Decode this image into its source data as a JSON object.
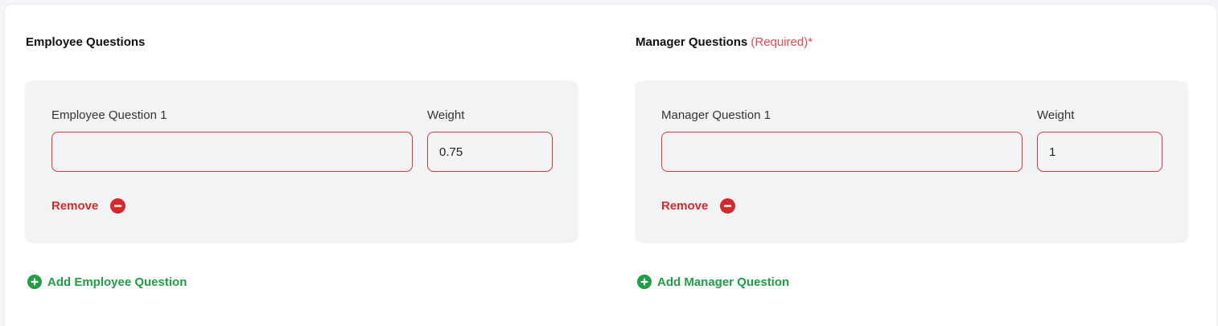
{
  "employee": {
    "title": "Employee Questions",
    "questions": [
      {
        "label": "Employee Question 1",
        "value": "",
        "weight_label": "Weight",
        "weight_value": "0.75",
        "remove_label": "Remove"
      }
    ],
    "add_label": "Add Employee Question"
  },
  "manager": {
    "title": "Manager Questions",
    "required_label": "(Required)*",
    "questions": [
      {
        "label": "Manager Question 1",
        "value": "",
        "weight_label": "Weight",
        "weight_value": "1",
        "remove_label": "Remove"
      }
    ],
    "add_label": "Add Manager Question"
  },
  "colors": {
    "error_border": "#d9363e",
    "remove": "#d42a2a",
    "add": "#1e9e45",
    "required": "#e5484d"
  },
  "icons": {
    "remove": "minus-circle-icon",
    "add": "plus-circle-icon"
  }
}
